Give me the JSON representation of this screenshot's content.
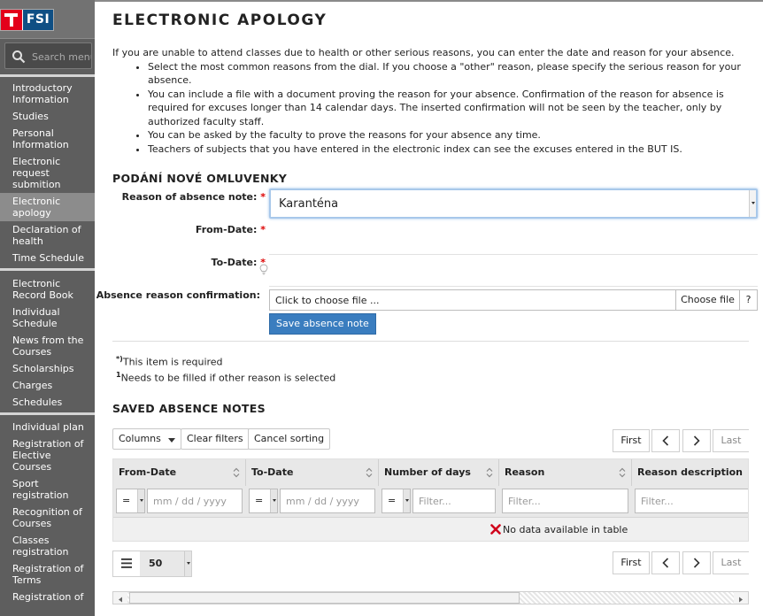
{
  "logo": {
    "text": "FSI"
  },
  "search": {
    "placeholder": "Search menu"
  },
  "sidebar": {
    "groups": [
      [
        {
          "label": "Introductory Information"
        },
        {
          "label": "Studies"
        },
        {
          "label": "Personal Information"
        },
        {
          "label": "Electronic request submition"
        },
        {
          "label": "Electronic apology",
          "active": true
        },
        {
          "label": "Declaration of health"
        },
        {
          "label": "Time Schedule"
        }
      ],
      [
        {
          "label": "Electronic Record Book"
        },
        {
          "label": "Individual Schedule"
        },
        {
          "label": "News from the Courses"
        },
        {
          "label": "Scholarships"
        },
        {
          "label": "Charges"
        },
        {
          "label": "Schedules"
        }
      ],
      [
        {
          "label": "Individual plan"
        },
        {
          "label": "Registration of Elective Courses"
        },
        {
          "label": "Sport registration"
        },
        {
          "label": "Recognition of Courses"
        },
        {
          "label": "Classes registration"
        },
        {
          "label": "Registration of Terms"
        },
        {
          "label": "Registration of"
        }
      ]
    ]
  },
  "page": {
    "title": "ELECTRONIC APOLOGY",
    "intro": "If you are unable to attend classes due to health or other serious reasons, you can enter the date and reason for your absence.",
    "bullets": [
      "Select the most common reasons from the dial. If you choose a \"other\" reason, please specify the serious reason for your absence.",
      "You can include a file with a document proving the reason for your absence. Confirmation of the reason for absence is required for excuses longer than 14 calendar days. The inserted confirmation will not be seen by the teacher, only by authorized faculty staff.",
      "You can be asked by the faculty to prove the reasons for your absence any time.",
      "Teachers of subjects that you have entered in the electronic index can see the excuses entered in the BUT IS."
    ]
  },
  "form": {
    "section_title": "PODÁNÍ NOVÉ OMLUVENKY",
    "reason_label": "Reason of absence note:",
    "reason_value": "Karanténa",
    "from_label": "From-Date:",
    "to_label": "To-Date:",
    "file_label": "Absence reason confirmation:",
    "file_text": "Click to choose file ...",
    "choose_file": "Choose file",
    "help": "?",
    "save": "Save absence note",
    "required_mark": "*",
    "note_required_sup": "*)",
    "note_required": "This item is required",
    "note_other_sup": "1",
    "note_other": "Needs to be filled if other reason is selected"
  },
  "saved": {
    "section_title": "SAVED ABSENCE NOTES",
    "toolbar": {
      "columns": "Columns",
      "clear_filters": "Clear filters",
      "cancel_sorting": "Cancel sorting"
    },
    "pager": {
      "first": "First",
      "last": "Last"
    },
    "columns": [
      {
        "header": "From-Date",
        "operator": "=",
        "placeholder": "mm / dd / yyyy"
      },
      {
        "header": "To-Date",
        "operator": "=",
        "placeholder": "mm / dd / yyyy"
      },
      {
        "header": "Number of days",
        "operator": "=",
        "placeholder": "Filter..."
      },
      {
        "header": "Reason",
        "placeholder": "Filter..."
      },
      {
        "header": "Reason description",
        "placeholder": "Filter..."
      }
    ],
    "empty": "No data available in table",
    "page_size": "50"
  },
  "colors": {
    "accent": "#3a7dbf",
    "sidebar": "#5e5e5e",
    "logo_red": "#e3001b",
    "logo_blue": "#0f4f84"
  }
}
